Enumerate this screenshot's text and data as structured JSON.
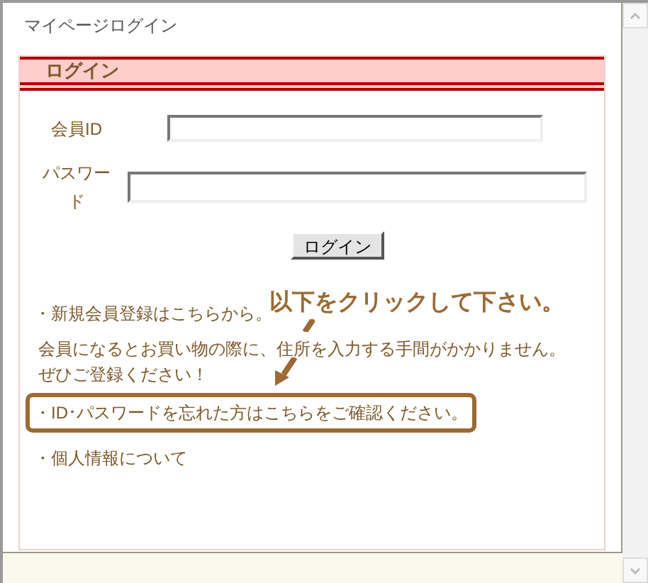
{
  "page": {
    "title": "マイページログイン"
  },
  "section": {
    "heading": "ログイン"
  },
  "fields": [
    {
      "label": "会員ID",
      "kind": "text"
    },
    {
      "label": "パスワード",
      "kind": "password"
    }
  ],
  "submit_button": "ログイン",
  "register_link": "・新規会員登録はこちらから。",
  "register_note": [
    "会員になるとお買い物の際に、住所を入力する手間がかかりません。",
    "ぜひご登録ください！"
  ],
  "links": [
    {
      "text": "・ID･パスワードを忘れた方はこちらをご確認ください。",
      "highlighted": true
    },
    {
      "text": "・個人情報について",
      "highlighted": false
    }
  ],
  "annotation": {
    "text": "以下をクリックして下さい。"
  }
}
